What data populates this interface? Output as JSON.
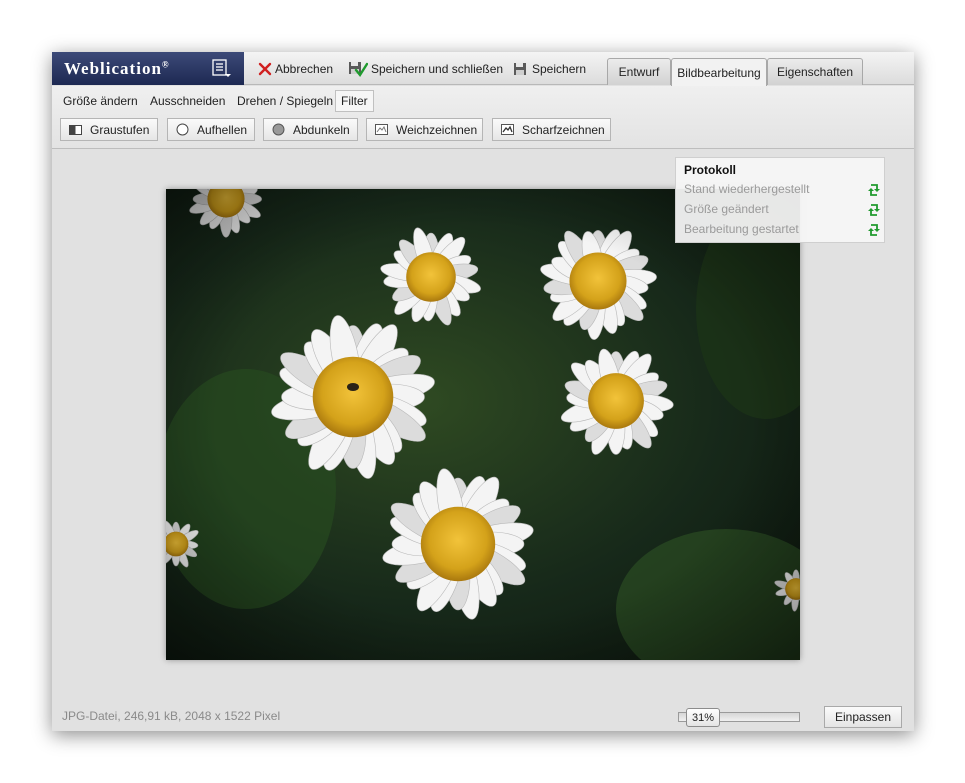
{
  "app": {
    "logo": "Weblication",
    "registered_mark": "®"
  },
  "toolbar": {
    "cancel_label": "Abbrechen",
    "save_close_label": "Speichern und schließen",
    "save_label": "Speichern"
  },
  "tabs": [
    {
      "label": "Entwurf",
      "active": false
    },
    {
      "label": "Bildbearbeitung",
      "active": true
    },
    {
      "label": "Eigenschaften",
      "active": false
    }
  ],
  "subtabs": [
    {
      "label": "Größe ändern",
      "active": false
    },
    {
      "label": "Ausschneiden",
      "active": false
    },
    {
      "label": "Drehen / Spiegeln",
      "active": false
    },
    {
      "label": "Filter",
      "active": true
    }
  ],
  "filters": [
    {
      "label": "Graustufen",
      "icon": "grayscale-icon"
    },
    {
      "label": "Aufhellen",
      "icon": "brighten-icon"
    },
    {
      "label": "Abdunkeln",
      "icon": "darken-icon"
    },
    {
      "label": "Weichzeichnen",
      "icon": "blur-icon"
    },
    {
      "label": "Scharfzeichnen",
      "icon": "sharpen-icon"
    }
  ],
  "protokoll": {
    "title": "Protokoll",
    "items": [
      {
        "label": "Stand wiederhergestellt"
      },
      {
        "label": "Größe geändert"
      },
      {
        "label": "Bearbeitung gestartet"
      }
    ]
  },
  "status": {
    "file_info": "JPG-Datei, 246,91 kB, 2048 x 1522 Pixel"
  },
  "zoom": {
    "value": "31%"
  },
  "fit_button": "Einpassen",
  "colors": {
    "logo_bg": "#1d2952",
    "cancel_red": "#d02020",
    "restore_green": "#1f9a2e",
    "daisy_center": "#d4a21a"
  }
}
